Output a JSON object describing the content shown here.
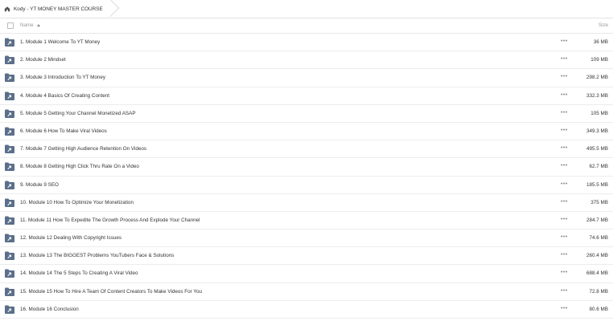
{
  "breadcrumb": {
    "root": "Kody - YT MONEY MASTER COURSE"
  },
  "header": {
    "name_label": "Name",
    "size_label": "Size"
  },
  "rows": [
    {
      "name": "1. Module 1 Welcome To YT Money",
      "size": "36 MB"
    },
    {
      "name": "2. Module 2 Mindset",
      "size": "109 MB"
    },
    {
      "name": "3. Module 3 Introduction To YT Money",
      "size": "298.2 MB"
    },
    {
      "name": "4. Module 4 Basics Of Creating Content",
      "size": "332.3 MB"
    },
    {
      "name": "5. Module 5 Getting Your Channel Monetized ASAP",
      "size": "105 MB"
    },
    {
      "name": "6. Module 6 How To Make Viral Videos",
      "size": "349.3 MB"
    },
    {
      "name": "7. Module 7 Getting High Audience Retention On Videos",
      "size": "495.5 MB"
    },
    {
      "name": "8. Module 8 Getting High Click Thru Rate On a Video",
      "size": "62.7 MB"
    },
    {
      "name": "9. Module 9 SEO",
      "size": "185.5 MB"
    },
    {
      "name": "10. Module 10 How To Optimize Your Monetization",
      "size": "375 MB"
    },
    {
      "name": "11. Module 11 How To Expedite The Growth Process And Explode Your Channel",
      "size": "284.7 MB"
    },
    {
      "name": "12. Module 12 Dealing With Copyright Issues",
      "size": "74.6 MB"
    },
    {
      "name": "13. Module 13 The BIGGEST Problems YouTubers Face & Solutions",
      "size": "260.4 MB"
    },
    {
      "name": "14. Module 14 The 5 Steps To Creating A Viral Video",
      "size": "688.4 MB"
    },
    {
      "name": "15. Module 15 How To Hire A Team Of Content Creators To Make Videos For You",
      "size": "72.8 MB"
    },
    {
      "name": "16. Module 16 Conclusion",
      "size": "80.6 MB"
    }
  ],
  "row_menu_glyph": "•••",
  "icons": {
    "breadcrumb": "cloud-home-icon",
    "row": "shared-folder-icon"
  },
  "colors": {
    "folder": "#5b6f8a",
    "border": "#e8e8e8"
  }
}
